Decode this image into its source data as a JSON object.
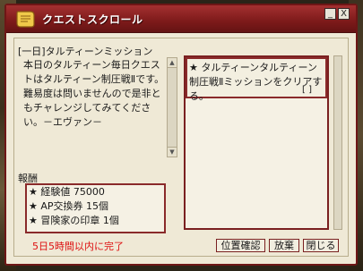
{
  "window": {
    "title": "クエストスクロール",
    "minimize_symbol": "_",
    "close_symbol": "X"
  },
  "mission": {
    "title": "[一日]タルティーンミッション",
    "description": "本日のタルティーン毎日クエストはタルティーン制圧戦Ⅱです。難易度は問いませんので是非ともチャレンジしてみてください。－エヴァン－"
  },
  "goal": {
    "text": "★ タルティーンタルティーン制圧戦Ⅱミッションをクリアする。",
    "progress": "[ ]"
  },
  "reward": {
    "label": "報酬",
    "items": [
      "★ 経験値 75000",
      "★ AP交換券 15個",
      "★ 冒険家の印章 1個"
    ]
  },
  "deadline": "5日5時間以内に完了",
  "buttons": {
    "locate": "位置確認",
    "abandon": "放棄",
    "close": "閉じる"
  },
  "colors": {
    "title_bar": "#7d1a1a",
    "panel_bg": "#efe9d6",
    "deadline_text": "#dd1111"
  }
}
